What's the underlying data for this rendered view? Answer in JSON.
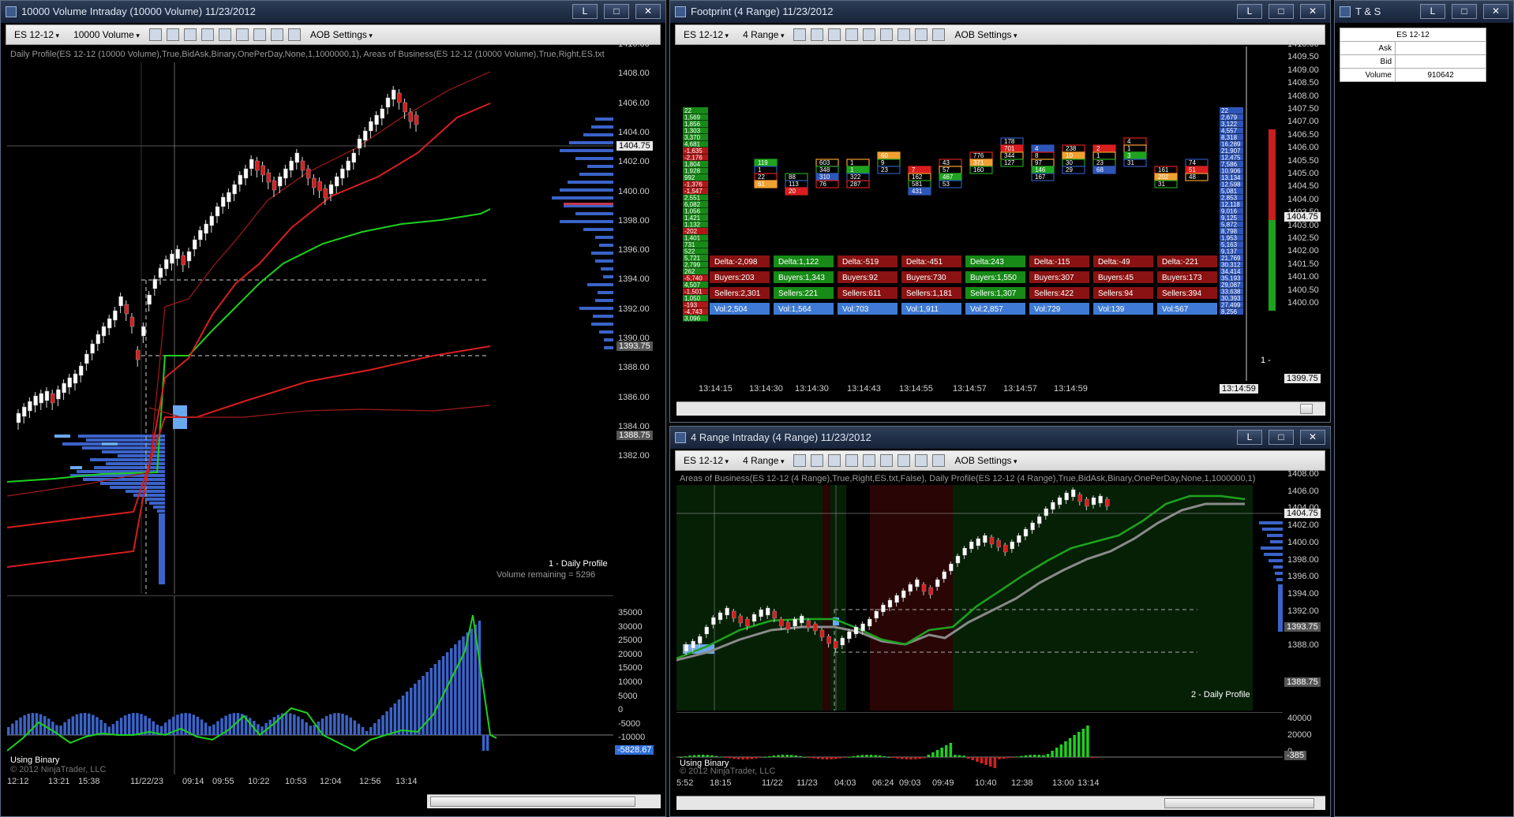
{
  "left_window": {
    "title": "10000 Volume Intraday (10000 Volume)  11/23/2012",
    "instrument": "ES 12-12",
    "period": "10000 Volume",
    "aob_settings": "AOB Settings",
    "indicator_line": "Daily Profile(ES 12-12 (10000 Volume),True,BidAsk,Binary,OnePerDay,None,1,1000000,1), Areas of Business(ES 12-12 (10000 Volume),True,Right,ES.txt",
    "price_axis": [
      "1410.00",
      "1408.00",
      "1406.00",
      "1404.00",
      "1402.00",
      "1400.00",
      "1398.00",
      "1396.00",
      "1394.00",
      "1392.00",
      "1390.00",
      "1388.00",
      "1386.00",
      "1384.00",
      "1382.00"
    ],
    "price_tags": {
      "current": "1404.75",
      "upper": "1393.75",
      "lower": "1388.75"
    },
    "profile_label": "1 - Daily Profile",
    "volume_remaining": "Volume remaining = 5296",
    "osc_axis": [
      "35000",
      "30000",
      "25000",
      "20000",
      "15000",
      "10000",
      "5000",
      "0",
      "-5000",
      "-10000"
    ],
    "osc_value": "-5828.67",
    "using_binary": "Using Binary",
    "copyright": "© 2012 NinjaTrader, LLC",
    "time_axis": [
      "12:12",
      "13:21",
      "15:38",
      "11/22/23",
      "09:14",
      "09:55",
      "10:22",
      "10:53",
      "12:04",
      "12:56",
      "13:14"
    ]
  },
  "footprint_window": {
    "title": "Footprint (4 Range)  11/23/2012",
    "instrument": "ES 12-12",
    "period": "4 Range",
    "aob_settings": "AOB Settings",
    "price_axis": [
      "1410.00",
      "1409.50",
      "1409.00",
      "1408.50",
      "1408.00",
      "1407.50",
      "1407.00",
      "1406.50",
      "1406.00",
      "1405.50",
      "1405.00",
      "1404.50",
      "1404.00",
      "1403.50",
      "1403.00",
      "1402.50",
      "1402.00",
      "1401.50",
      "1401.00",
      "1400.50",
      "1400.00"
    ],
    "price_tags": {
      "current": "1404.75",
      "low": "1399.75"
    },
    "left_column": [
      "22",
      "1,569",
      "1,856",
      "1,303",
      "3,370",
      "4,681",
      "-1,635",
      "-2,176",
      "1,804",
      "1,928",
      "992",
      "-1,376",
      "-1,547",
      "2,551",
      "6,082",
      "1,056",
      "1,421",
      "1,132",
      "-202",
      "1,401",
      "731",
      "522",
      "5,721",
      "2,799",
      "262",
      "-5,740",
      "4,507",
      "-1,501",
      "1,050",
      "-193",
      "-4,743",
      "3,096"
    ],
    "right_column": [
      "22",
      "2,679",
      "3,122",
      "4,557",
      "8,318",
      "16,289",
      "21,907",
      "12,475",
      "7,586",
      "10,906",
      "13,134",
      "12,598",
      "5,081",
      "2,853",
      "12,118",
      "9,016",
      "9,125",
      "5,872",
      "8,798",
      "1,953",
      "5,163",
      "9,137",
      "21,769",
      "30,312",
      "34,414",
      "35,193",
      "29,087",
      "33,638",
      "30,393",
      "27,499",
      "8,256"
    ],
    "summary_rows": {
      "delta": [
        "Delta:-2,098",
        "Delta:1,122",
        "Delta:-519",
        "Delta:-451",
        "Delta:243",
        "Delta:-115",
        "Delta:-49",
        "Delta:-221"
      ],
      "buyers": [
        "Buyers:203",
        "Buyers:1,343",
        "Buyers:92",
        "Buyers:730",
        "Buyers:1,550",
        "Buyers:307",
        "Buyers:45",
        "Buyers:173"
      ],
      "sellers": [
        "Sellers:2,301",
        "Sellers:221",
        "Sellers:611",
        "Sellers:1,181",
        "Sellers:1,307",
        "Sellers:422",
        "Sellers:94",
        "Sellers:394"
      ],
      "vol": [
        "Vol:2,504",
        "Vol:1,564",
        "Vol:703",
        "Vol:1,911",
        "Vol:2,857",
        "Vol:729",
        "Vol:139",
        "Vol:567"
      ]
    },
    "time_axis": [
      "13:14:15",
      "13:14:30",
      "13:14:30",
      "13:14:43",
      "13:14:55",
      "13:14:57",
      "13:14:57",
      "13:14:59"
    ],
    "current_time": "13:14:59",
    "right_marker": "1 -",
    "cells": [
      {
        "col": 1,
        "row": 0,
        "a": "119"
      },
      {
        "col": 1,
        "row": 1,
        "a": "1"
      },
      {
        "col": 1,
        "row": 2,
        "a": "22"
      },
      {
        "col": 1,
        "row": 3,
        "a": "61"
      },
      {
        "col": 2,
        "row": 2,
        "a": "88"
      },
      {
        "col": 2,
        "row": 3,
        "a": "113"
      },
      {
        "col": 2,
        "row": 4,
        "a": "20"
      },
      {
        "col": 3,
        "row": 0,
        "a": "603"
      },
      {
        "col": 3,
        "row": 1,
        "a": "348"
      },
      {
        "col": 3,
        "row": 2,
        "a": "310"
      },
      {
        "col": 3,
        "row": 3,
        "a": "76"
      },
      {
        "col": 4,
        "row": 0,
        "a": "1"
      },
      {
        "col": 4,
        "row": 1,
        "a": "1"
      },
      {
        "col": 4,
        "row": 2,
        "a": "322"
      },
      {
        "col": 4,
        "row": 3,
        "a": "287"
      },
      {
        "col": 5,
        "row": -1,
        "a": "60"
      },
      {
        "col": 5,
        "row": 0,
        "a": "9"
      },
      {
        "col": 5,
        "row": 1,
        "a": "23"
      },
      {
        "col": 6,
        "row": 1,
        "a": "7"
      },
      {
        "col": 6,
        "row": 2,
        "a": "162"
      },
      {
        "col": 6,
        "row": 3,
        "a": "581"
      },
      {
        "col": 6,
        "row": 4,
        "a": "431"
      },
      {
        "col": 7,
        "row": 0,
        "a": "43"
      },
      {
        "col": 7,
        "row": 1,
        "a": "57"
      },
      {
        "col": 7,
        "row": 2,
        "a": "467"
      },
      {
        "col": 7,
        "row": 3,
        "a": "53"
      },
      {
        "col": 8,
        "row": -1,
        "a": "776"
      },
      {
        "col": 8,
        "row": 0,
        "a": "371"
      },
      {
        "col": 8,
        "row": 1,
        "a": "160"
      },
      {
        "col": 9,
        "row": -3,
        "a": "178"
      },
      {
        "col": 9,
        "row": -2,
        "a": "701"
      },
      {
        "col": 9,
        "row": -1,
        "a": "344"
      },
      {
        "col": 9,
        "row": 0,
        "a": "127"
      },
      {
        "col": 10,
        "row": -2,
        "a": "4"
      },
      {
        "col": 10,
        "row": -1,
        "a": "8"
      },
      {
        "col": 10,
        "row": 0,
        "a": "97"
      },
      {
        "col": 10,
        "row": 1,
        "a": "146"
      },
      {
        "col": 10,
        "row": 2,
        "a": "167"
      },
      {
        "col": 11,
        "row": -2,
        "a": "238"
      },
      {
        "col": 11,
        "row": -1,
        "a": "10"
      },
      {
        "col": 11,
        "row": 0,
        "a": "30"
      },
      {
        "col": 11,
        "row": 1,
        "a": "29"
      },
      {
        "col": 12,
        "row": -2,
        "a": "2"
      },
      {
        "col": 12,
        "row": -1,
        "a": "1"
      },
      {
        "col": 12,
        "row": 0,
        "a": "23"
      },
      {
        "col": 12,
        "row": 1,
        "a": "68"
      },
      {
        "col": 13,
        "row": -3,
        "a": "4"
      },
      {
        "col": 13,
        "row": -2,
        "a": "1"
      },
      {
        "col": 13,
        "row": -1,
        "a": "3"
      },
      {
        "col": 13,
        "row": 0,
        "a": "31"
      },
      {
        "col": 14,
        "row": 1,
        "a": "161"
      },
      {
        "col": 14,
        "row": 2,
        "a": "202"
      },
      {
        "col": 14,
        "row": 3,
        "a": "31"
      },
      {
        "col": 15,
        "row": 0,
        "a": "74"
      },
      {
        "col": 15,
        "row": 1,
        "a": "51"
      },
      {
        "col": 15,
        "row": 2,
        "a": "48"
      }
    ]
  },
  "range_window": {
    "title": "4 Range Intraday (4 Range)  11/23/2012",
    "instrument": "ES 12-12",
    "period": "4 Range",
    "aob_settings": "AOB Settings",
    "indicator_line": "Areas of Business(ES 12-12 (4 Range),True,Right,ES.txt,False), Daily Profile(ES 12-12 (4 Range),True,BidAsk,Binary,OnePerDay,None,1,1000000,1)",
    "price_axis": [
      "1408.00",
      "1406.00",
      "1404.00",
      "1402.00",
      "1400.00",
      "1398.00",
      "1396.00",
      "1394.00",
      "1392.00",
      "1390.00",
      "1388.00"
    ],
    "price_tags": {
      "current": "1404.75",
      "upper": "1393.75",
      "lower": "1388.75"
    },
    "profile_label": "2 - Daily Profile",
    "osc_axis": [
      "40000",
      "20000",
      "0"
    ],
    "osc_value": "-385",
    "using_binary": "Using Binary",
    "copyright": "© 2012 NinjaTrader, LLC",
    "time_axis": [
      "5:52",
      "18:15",
      "11/22",
      "11/23",
      "04:03",
      "06:24",
      "09:03",
      "09:49",
      "10:40",
      "12:38",
      "13:00",
      "13:14"
    ]
  },
  "ts_window": {
    "title": "T & S",
    "instrument": "ES 12-12",
    "rows": [
      {
        "label": "Ask",
        "value": ""
      },
      {
        "label": "Bid",
        "value": ""
      },
      {
        "label": "Volume",
        "value": "910642"
      }
    ]
  },
  "window_buttons": {
    "restore": "L",
    "minimize": "□",
    "close": "✕"
  },
  "colors": {
    "bg": "#000000",
    "green_band": "#1ed11e",
    "red_band": "#d81e1e",
    "profile_blue": "#3b63c9",
    "profile_light": "#6aa8f0"
  }
}
